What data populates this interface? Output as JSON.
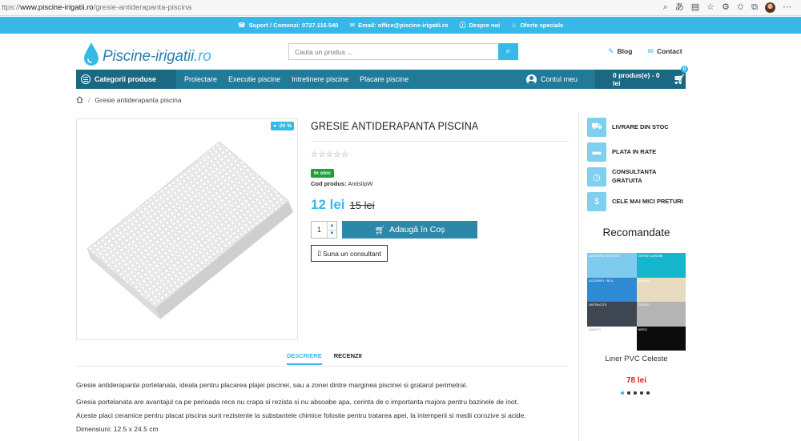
{
  "browser": {
    "url_prefix": "ttps://",
    "url_domain": "www.piscine-irigatii.ro",
    "url_path": "/gresie-antiderapanta-piscina"
  },
  "topbar": {
    "support": "Suport / Comenzi: 0727.116.540",
    "email": "Email: office@piscine-irigatii.ro",
    "about": "Despre noi",
    "offers": "Oferte speciale"
  },
  "header": {
    "logo_main": "Piscine-irigatii",
    "logo_tld": ".ro",
    "search_placeholder": "Cauta un produs ...",
    "blog": "Blog",
    "contact": "Contact"
  },
  "nav": {
    "categories": "Categorii produse",
    "items": [
      "Proiectare",
      "Executie piscine",
      "Intretinere piscine",
      "Placare piscine"
    ],
    "account": "Contul meu",
    "cart": "0 produs(e) - 0 lei",
    "cart_count": "0"
  },
  "breadcrumb": {
    "current": "Gresie antiderapanta piscina"
  },
  "product": {
    "discount": "-20 %",
    "title": "GRESIE ANTIDERAPANTA PISCINA",
    "stars": "☆☆☆☆☆",
    "stock": "In stoc",
    "code_label": "Cod produs:",
    "code_value": "AntislipW",
    "price_now": "12 lei",
    "price_old": "15 lei",
    "qty": "1",
    "add_to_cart": "Adaugă în Coș",
    "consultant": "Suna un consultant"
  },
  "features": [
    {
      "label": "LIVRARE DIN STOC",
      "icon": "truck-icon"
    },
    {
      "label": "PLATA IN RATE",
      "icon": "credit-card-icon"
    },
    {
      "label": "CONSULTANTA",
      "label2": "GRATUITA",
      "icon": "clock-icon"
    },
    {
      "label": "CELE MAI MICI PRETURI",
      "icon": "dollar-icon"
    }
  ],
  "recommended": {
    "title": "Recomandate",
    "swatches": [
      {
        "label": "AZZURRO CELESTE",
        "color": "#7fcbef"
      },
      {
        "label": "VERDE CARAIBI",
        "color": "#17b6cf"
      },
      {
        "label": "AZZURRO / BLU",
        "color": "#2d8ad3"
      },
      {
        "label": "SABBIA",
        "color": "#e7dcc0"
      },
      {
        "label": "ANTRACITE",
        "color": "#3e4652"
      },
      {
        "label": "GRIGIO",
        "color": "#b4b4b4"
      },
      {
        "label": "BIANCO",
        "color": "#ffffff"
      },
      {
        "label": "NERO",
        "color": "#0c0c0c"
      }
    ],
    "name": "Liner PVC Celeste",
    "price": "78 lei"
  },
  "tabs": {
    "description": "DESCRIERE",
    "reviews": "RECENZII"
  },
  "description": {
    "p1": "Gresie antiderapanta portelanata, ideala pentru placarea plajei piscinei, sau a zonei dintre marginea piscinei si gratarul perimetral.",
    "p2": "Gresia portelanata are avantajul ca pe perioada rece nu crapa si rezista si nu absoabe apa, cerinta de o importanta majora pentru bazinele de inot.",
    "p3": "Aceste placi ceramice pentru placat piscina sunt rezistente la substantele chimice folosite pentru tratarea apei, la intemperii si medii corozive si acide.",
    "p4": "Dimensiuni: 12.5 x 24.5 cm"
  },
  "colors": {
    "accent": "#36b9e6",
    "nav": "#217b98",
    "price_red": "#e2231a",
    "stock_green": "#1f9e3a"
  }
}
